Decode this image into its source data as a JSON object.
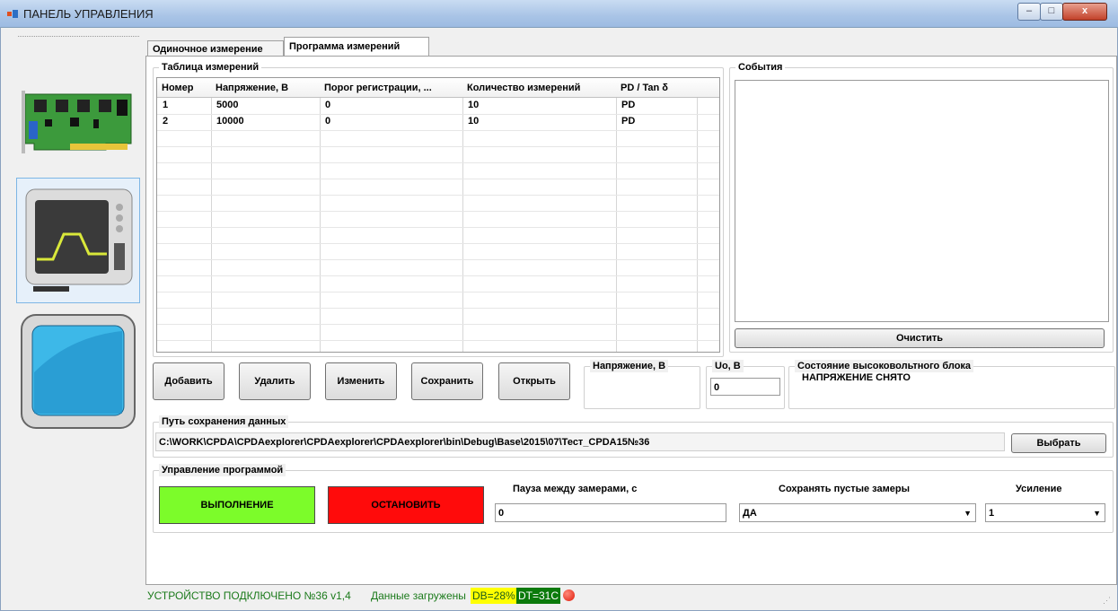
{
  "window": {
    "title": "ПАНЕЛЬ УПРАВЛЕНИЯ",
    "min": "–",
    "max": "□",
    "close": "x"
  },
  "tabs": [
    {
      "label": "Одиночное измерение",
      "active": false
    },
    {
      "label": "Программа измерений",
      "active": true
    }
  ],
  "table": {
    "group_title": "Таблица измерений",
    "columns": [
      "Номер",
      "Напряжение, В",
      "Порог регистрации, ...",
      "Количество измерений",
      "PD / Tan δ"
    ],
    "rows": [
      [
        "1",
        "5000",
        "0",
        "10",
        "PD"
      ],
      [
        "2",
        "10000",
        "0",
        "10",
        "PD"
      ]
    ]
  },
  "events": {
    "group_title": "События",
    "clear_label": "Очистить"
  },
  "actions": {
    "add": "Добавить",
    "delete": "Удалить",
    "edit": "Изменить",
    "save": "Сохранить",
    "open": "Открыть"
  },
  "voltage": {
    "title": "Напряжение, В"
  },
  "uo": {
    "title": "Uo, В",
    "value": "0"
  },
  "hv_state": {
    "title": "Состояние высоковольтного блока",
    "value": "НАПРЯЖЕНИЕ СНЯТО"
  },
  "path": {
    "title": "Путь сохранения данных",
    "value": "C:\\WORK\\CPDA\\CPDAexplorer\\CPDAexplorer\\CPDAexplorer\\bin\\Debug\\Base\\2015\\07\\Тест_CPDA15№36",
    "choose_label": "Выбрать"
  },
  "control": {
    "title": "Управление программой",
    "run_label": "ВЫПОЛНЕНИЕ",
    "stop_label": "ОСТАНОВИТЬ",
    "run_color": "#7cfc2a",
    "stop_color": "#ff0b0b",
    "pause_label": "Пауза между замерами, с",
    "pause_value": "0",
    "save_empty_label": "Сохранять пустые замеры",
    "save_empty_value": "ДА",
    "gain_label": "Усиление",
    "gain_value": "1"
  },
  "status": {
    "device": "УСТРОЙСТВО ПОДКЛЮЧЕНО №36 v1,4",
    "loaded": "Данные загружены",
    "db": "DB=28%",
    "dt": "DT=31C",
    "led_color": "#e01a0a"
  },
  "nav": [
    {
      "icon": "circuit-board-icon"
    },
    {
      "icon": "oscilloscope-icon",
      "selected": true
    },
    {
      "icon": "monitor-icon"
    }
  ]
}
